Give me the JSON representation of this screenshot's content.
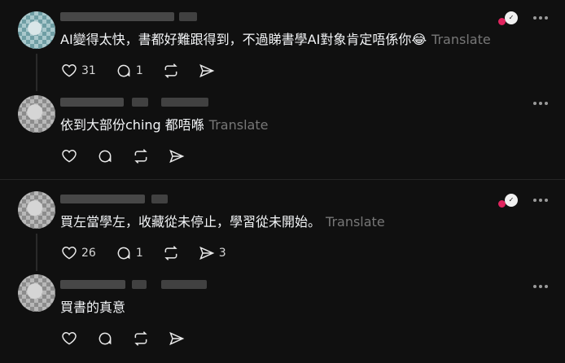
{
  "posts": [
    {
      "text": "AI變得太快，書都好難跟得到，不過睇書學AI對象肯定唔係你😂",
      "translate": "Translate",
      "likes": "31",
      "replies": "1",
      "shares": ""
    },
    {
      "text": "依到大部份ching 都唔喺",
      "translate": "Translate",
      "likes": "",
      "replies": "",
      "shares": ""
    },
    {
      "text": "買左當學左，收藏從未停止，學習從未開始。",
      "translate": "Translate",
      "likes": "26",
      "replies": "1",
      "shares": "3"
    },
    {
      "text": "買書的真意",
      "translate": "",
      "likes": "",
      "replies": "",
      "shares": ""
    }
  ],
  "icons": {
    "like": "heart-icon",
    "reply": "comment-icon",
    "repost": "repost-icon",
    "share": "send-icon",
    "more": "more-icon"
  },
  "colors": {
    "background": "#101010",
    "text": "#f3f5f7",
    "muted": "#777777",
    "accent": "#e0245e"
  }
}
